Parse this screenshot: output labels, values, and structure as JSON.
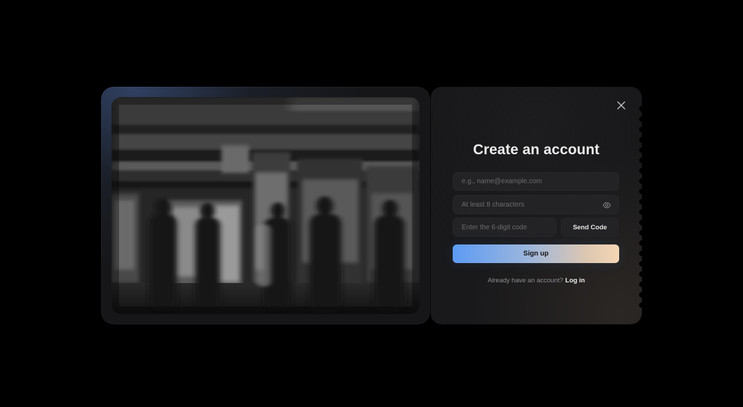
{
  "signup": {
    "title": "Create an account",
    "email_placeholder": "e.g., name@example.com",
    "password_placeholder": "At least 8 characters",
    "code_placeholder": "Enter the 6-digit code",
    "send_code_label": "Send Code",
    "submit_label": "Sign up",
    "login_prompt": "Already have an account?",
    "login_link": "Log in"
  },
  "icons": {
    "close": "close-icon",
    "password_visibility": "eye-icon"
  },
  "colors": {
    "background": "#000000",
    "card": "#1a1a1c",
    "field": "#232325",
    "button_gradient_start": "#5d9bf3",
    "button_gradient_end": "#f5d6b3"
  }
}
